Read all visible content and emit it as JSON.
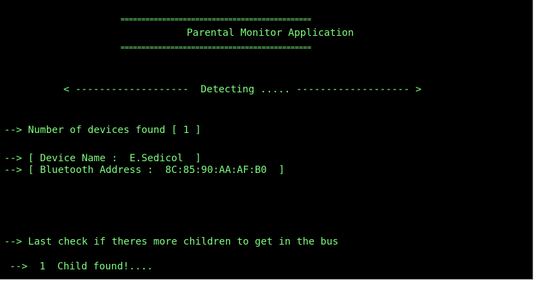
{
  "colors": {
    "background": "#000000",
    "text": "#7dfc7d"
  },
  "header": {
    "rule_top": "==============================================",
    "title": "Parental Monitor Application",
    "rule_bottom": "=============================================="
  },
  "status_line": "< -------------------  Detecting ..... ------------------- >",
  "devices": {
    "count_line": "--> Number of devices found [ 1 ]",
    "name_line": "--> [ Device Name :  E.Sedicol  ]",
    "address_line": "--> [ Bluetooth Address :  8C:85:90:AA:AF:B0  ]"
  },
  "last_check_line": "--> Last check if theres more children to get in the bus",
  "result_line": "-->  1  Child found!...."
}
